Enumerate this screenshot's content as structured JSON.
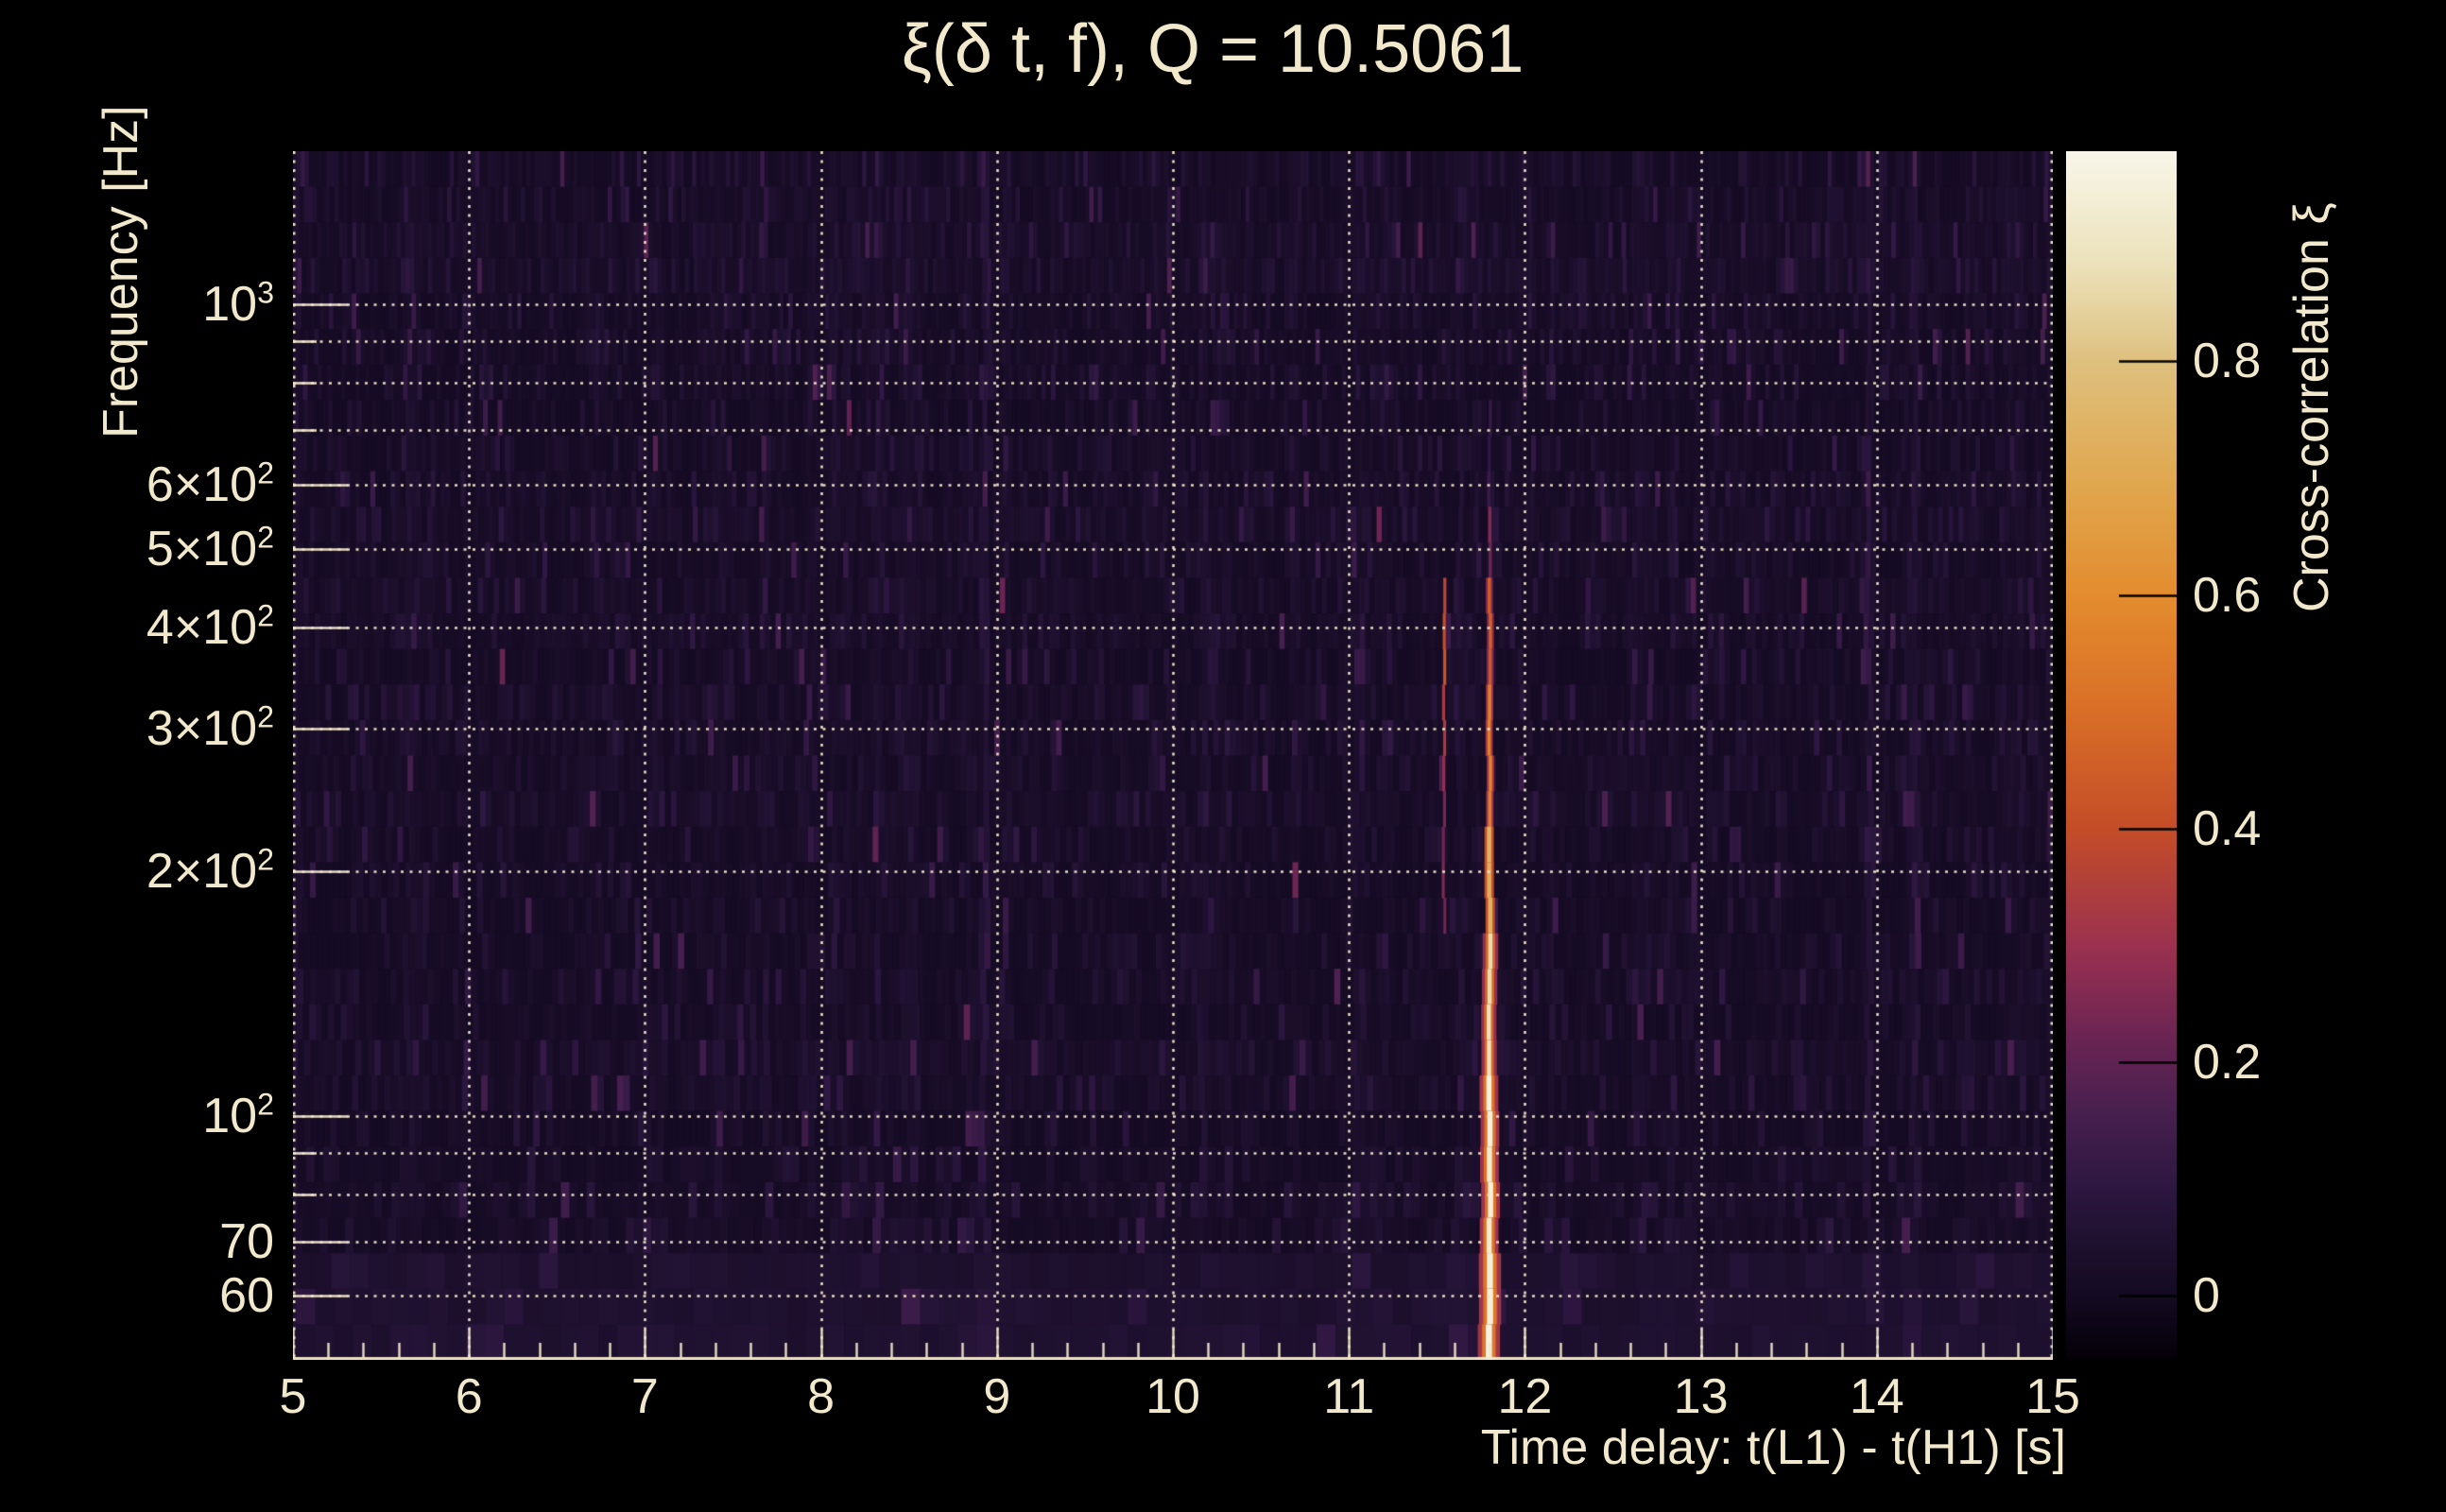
{
  "styles": {
    "background": "#000000",
    "text_color": "#f2e8cb",
    "grid_color": "#f2e8cb"
  },
  "chart_data": {
    "type": "heatmap",
    "title": "ξ(δ t, f), Q = 10.5061",
    "q_value": 10.5061,
    "xlabel": "Time delay: t(L1) - t(H1) [s]",
    "ylabel": "Frequency [Hz]",
    "x_range_s": [
      5,
      15
    ],
    "x_major_ticks": [
      {
        "value": 5,
        "label": "5"
      },
      {
        "value": 6,
        "label": "6"
      },
      {
        "value": 7,
        "label": "7"
      },
      {
        "value": 8,
        "label": "8"
      },
      {
        "value": 9,
        "label": "9"
      },
      {
        "value": 10,
        "label": "10"
      },
      {
        "value": 11,
        "label": "11"
      },
      {
        "value": 12,
        "label": "12"
      },
      {
        "value": 13,
        "label": "13"
      },
      {
        "value": 14,
        "label": "14"
      },
      {
        "value": 15,
        "label": "15"
      }
    ],
    "x_minor_tick_step_s": 0.2,
    "y_scale": "log",
    "y_range_hz": [
      50,
      1545
    ],
    "y_labeled_ticks": [
      {
        "hz": 1000,
        "base": "10",
        "sup": "3"
      },
      {
        "hz": 600,
        "base": "6×10",
        "sup": "2"
      },
      {
        "hz": 500,
        "base": "5×10",
        "sup": "2"
      },
      {
        "hz": 400,
        "base": "4×10",
        "sup": "2"
      },
      {
        "hz": 300,
        "base": "3×10",
        "sup": "2"
      },
      {
        "hz": 200,
        "base": "2×10",
        "sup": "2"
      },
      {
        "hz": 100,
        "base": "10",
        "sup": "2"
      },
      {
        "hz": 70,
        "base": "70",
        "sup": ""
      },
      {
        "hz": 60,
        "base": "60",
        "sup": ""
      }
    ],
    "y_gridlines_hz": [
      1000,
      900,
      800,
      700,
      600,
      500,
      400,
      300,
      200,
      100,
      90,
      80,
      70,
      60
    ],
    "grid": "dotted",
    "colorbar": {
      "label": "Cross-correlation ξ",
      "range": [
        -0.054,
        0.98
      ],
      "tick_values": [
        0,
        0.2,
        0.4,
        0.6,
        0.8
      ],
      "tick_labels": [
        "0",
        "0.2",
        "0.4",
        "0.6",
        "0.8"
      ],
      "colormap_stops": [
        [
          -0.054,
          "#050008"
        ],
        [
          0.0,
          "#140a22"
        ],
        [
          0.05,
          "#1f1130"
        ],
        [
          0.1,
          "#301843"
        ],
        [
          0.16,
          "#49204f"
        ],
        [
          0.22,
          "#6a2453"
        ],
        [
          0.3,
          "#9b3150"
        ],
        [
          0.4,
          "#c44d28"
        ],
        [
          0.5,
          "#d96e27"
        ],
        [
          0.6,
          "#e38c2e"
        ],
        [
          0.7,
          "#e0a850"
        ],
        [
          0.8,
          "#dec07e"
        ],
        [
          0.88,
          "#ebe0b8"
        ],
        [
          0.95,
          "#f4f0da"
        ],
        [
          0.98,
          "#f8f5e9"
        ]
      ]
    },
    "features": {
      "primary_ridge": {
        "time_delay_s": 11.8,
        "freq_span_hz": [
          50,
          750
        ],
        "peak_xi": 0.97,
        "profile_xi_by_freq": [
          {
            "f_max_hz": 65,
            "xi": 0.96
          },
          {
            "f_max_hz": 110,
            "xi": 0.94
          },
          {
            "f_max_hz": 160,
            "xi": 0.87
          },
          {
            "f_max_hz": 230,
            "xi": 0.74
          },
          {
            "f_max_hz": 330,
            "xi": 0.57
          },
          {
            "f_max_hz": 480,
            "xi": 0.45
          },
          {
            "f_max_hz": 560,
            "xi": 0.24
          },
          {
            "f_max_hz": 750,
            "xi": 0.11
          }
        ]
      },
      "secondary_ridge": {
        "time_delay_s": 11.54,
        "freq_span_hz": [
          160,
          460
        ],
        "peak_xi": 0.4
      },
      "noise_floor": {
        "xi_mean": 0.03,
        "xi_max": 0.22,
        "seed": 20250514,
        "rows": 34
      }
    }
  }
}
